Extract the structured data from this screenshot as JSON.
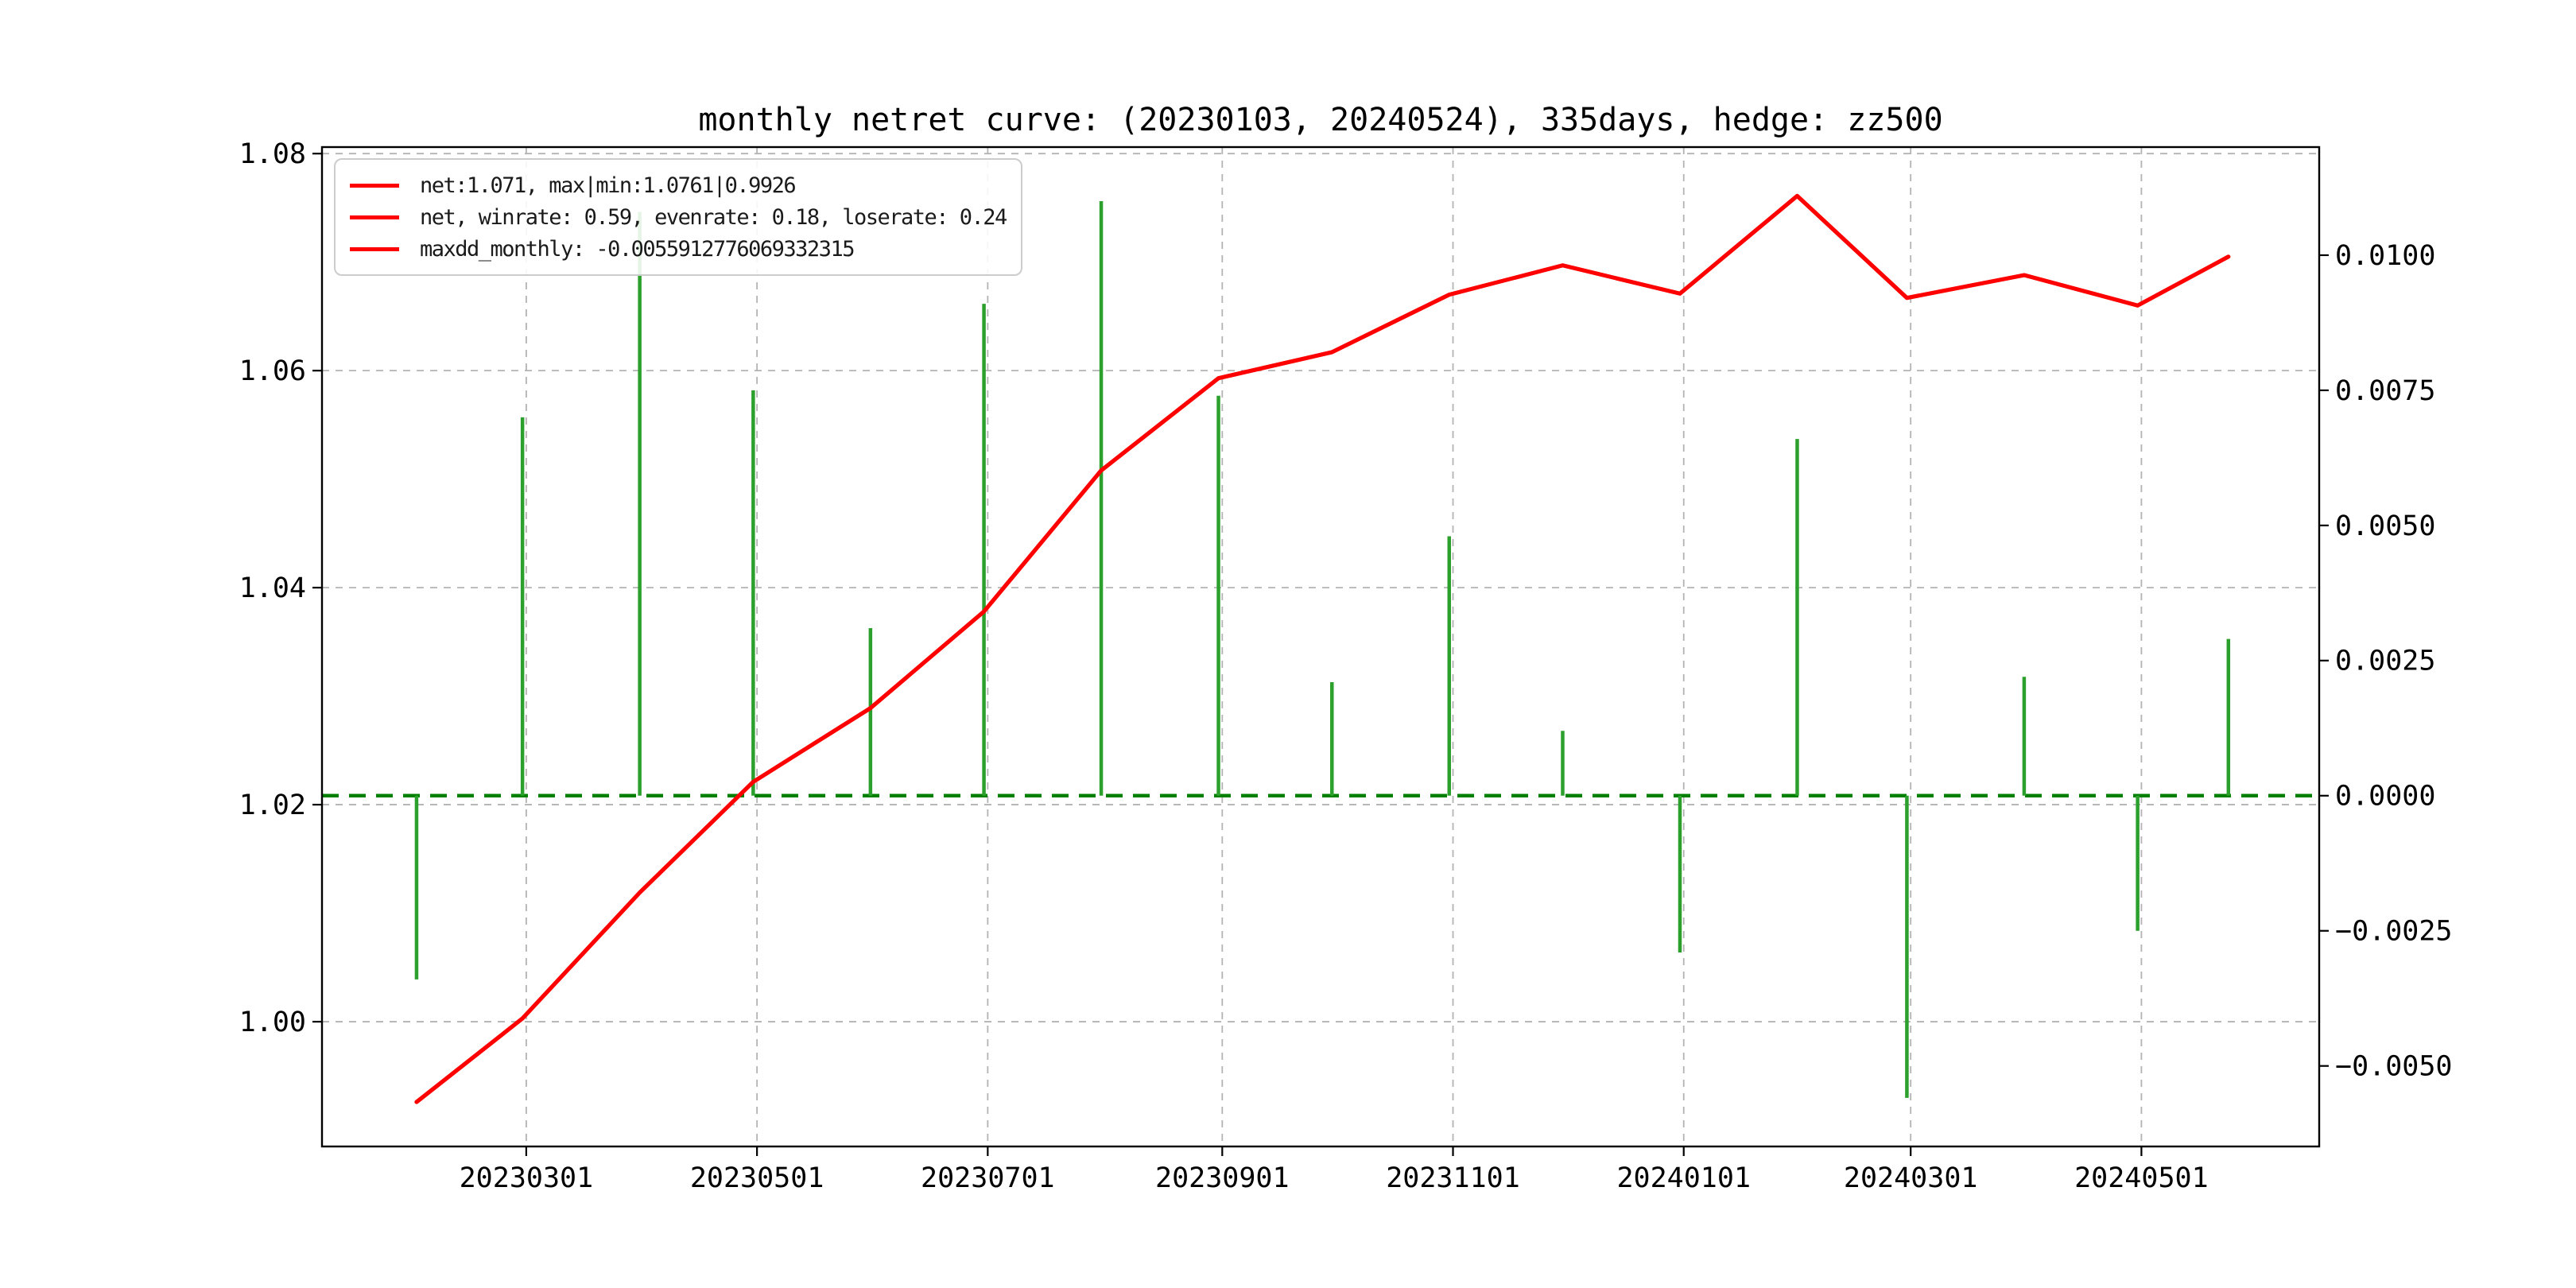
{
  "title": "monthly netret curve: (20230103, 20240524), 335days, hedge: zz500",
  "legend": {
    "swatch_color": "#ff0000",
    "items": [
      {
        "label": "net:1.071, max|min:1.0761|0.9926"
      },
      {
        "label": "net, winrate: 0.59, evenrate: 0.18, loserate: 0.24"
      },
      {
        "label": "maxdd_monthly: -0.0055912776069332315"
      }
    ]
  },
  "chart_data": {
    "type": "line+bar",
    "title": "monthly netret curve: (20230103, 20240524), 335days, hedge: zz500",
    "x_dates": [
      "20230131",
      "20230228",
      "20230331",
      "20230430",
      "20230531",
      "20230630",
      "20230731",
      "20230831",
      "20230930",
      "20231031",
      "20231130",
      "20231231",
      "20240131",
      "20240229",
      "20240331",
      "20240430",
      "20240524"
    ],
    "series": [
      {
        "name": "net",
        "type": "line",
        "axis": "left",
        "color": "#ff0000",
        "values": [
          0.9926,
          1.0003,
          1.0119,
          1.0221,
          1.0289,
          1.0378,
          1.0508,
          1.0593,
          1.0617,
          1.067,
          1.0697,
          1.0671,
          1.0761,
          1.0667,
          1.0688,
          1.066,
          1.0705
        ]
      },
      {
        "name": "monthly_return",
        "type": "bar",
        "axis": "right",
        "color": "#2ca02c",
        "values": [
          -0.0034,
          0.007,
          0.0108,
          0.0075,
          0.0031,
          0.0091,
          0.011,
          0.0074,
          0.0021,
          0.0048,
          0.0012,
          -0.0029,
          0.0066,
          -0.00559,
          0.0022,
          -0.0025,
          0.0029
        ]
      }
    ],
    "zero_line": {
      "axis": "right",
      "value": 0,
      "color": "#008000",
      "style": "dashed"
    },
    "x_tick_labels": [
      "20230301",
      "20230501",
      "20230701",
      "20230901",
      "20231101",
      "20240101",
      "20240301",
      "20240501"
    ],
    "left_ticks": [
      1.0,
      1.02,
      1.04,
      1.06,
      1.08
    ],
    "left_tick_labels": [
      "1.00",
      "1.02",
      "1.04",
      "1.06",
      "1.08"
    ],
    "right_ticks": [
      0.01,
      0.0075,
      0.005,
      0.0025,
      0.0,
      -0.0025,
      -0.005
    ],
    "right_tick_labels": [
      "0.0100",
      "0.0075",
      "0.0050",
      "0.0025",
      "0.0000",
      "−0.0025",
      "−0.0050"
    ],
    "xlim": [
      "20230106",
      "20240617"
    ],
    "left_ylim": [
      0.9885,
      1.0806
    ],
    "right_ylim": [
      -0.00649,
      0.012
    ],
    "grid": true,
    "grid_color": "#b3b3b3",
    "legend_position": "upper-left",
    "stats": {
      "net_final": 1.071,
      "net_max": 1.0761,
      "net_min": 0.9926,
      "winrate": 0.59,
      "evenrate": 0.18,
      "loserate": 0.24,
      "maxdd_monthly": -0.0055912776069332315
    }
  }
}
